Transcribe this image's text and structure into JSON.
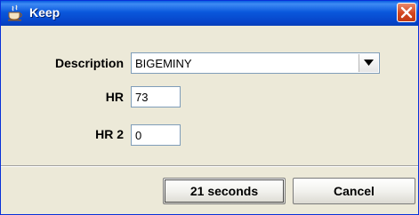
{
  "window": {
    "title": "Keep",
    "title_icon": "java-cup-icon",
    "close_icon": "close-icon"
  },
  "form": {
    "description_label": "Description",
    "description_value": "BIGEMINY",
    "hr_label": "HR",
    "hr_value": "73",
    "hr2_label": "HR 2",
    "hr2_value": "0"
  },
  "buttons": {
    "confirm_label": "21 seconds",
    "cancel_label": "Cancel"
  },
  "colors": {
    "titlebar": "#0a58dc",
    "close": "#d2451d",
    "background": "#ece9d8"
  }
}
